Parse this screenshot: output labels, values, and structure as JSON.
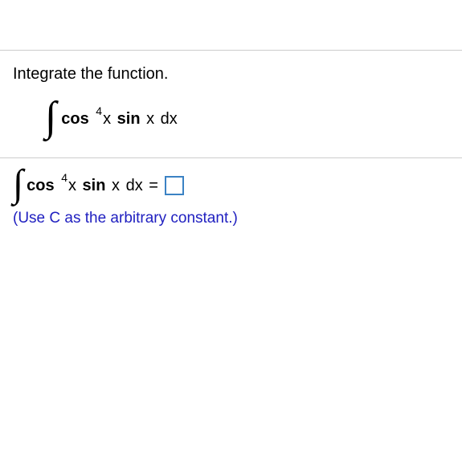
{
  "problem": {
    "instruction": "Integrate the function.",
    "integralFunc": {
      "cos": "cos",
      "exp": "4",
      "x1": "x",
      "sin": "sin",
      "x2": "x",
      "dx": "dx"
    }
  },
  "answer": {
    "lhs": {
      "cos": "cos",
      "exp": "4",
      "x1": "x",
      "sin": "sin",
      "x2": "x",
      "dx": "dx",
      "equals": "="
    },
    "hint": "(Use C as the arbitrary constant.)"
  }
}
